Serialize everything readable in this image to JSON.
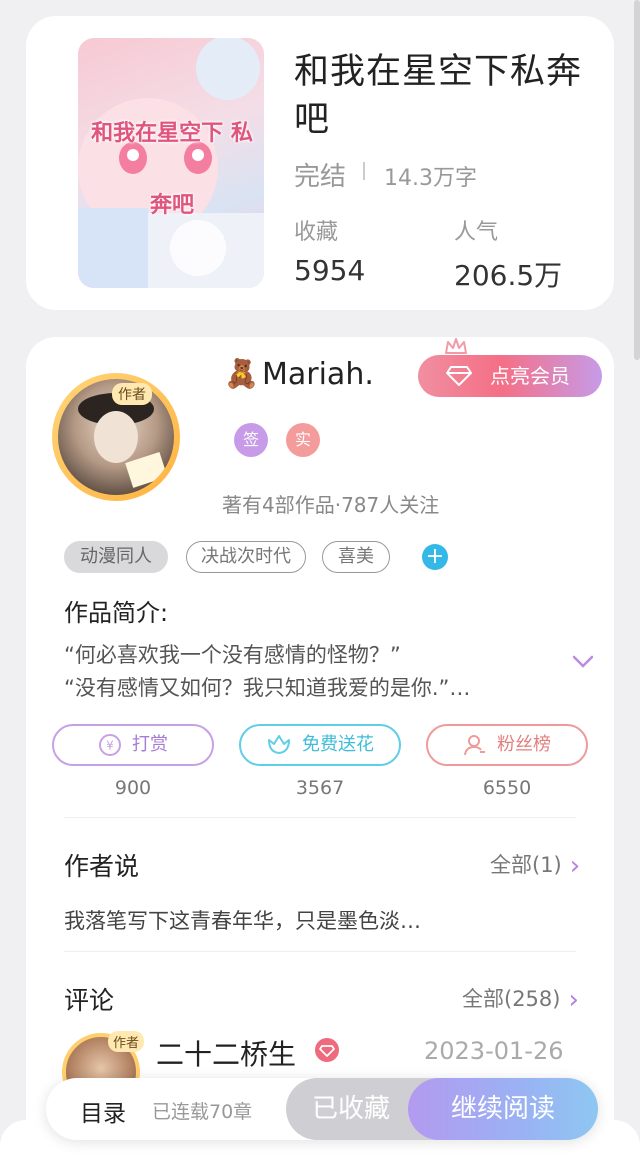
{
  "book": {
    "title": "和我在星空下私奔吧",
    "status": "完结",
    "words": "14.3万字",
    "collect_label": "收藏",
    "collect_value": "5954",
    "popularity_label": "人气",
    "popularity_value": "206.5万",
    "cover_text": "和我在星空下 私奔吧"
  },
  "author": {
    "emoji": "🧸",
    "name": "Mariah.",
    "avatar_badge": "作者",
    "vip_label": "点亮会员",
    "badge_sign": "签",
    "badge_real": "实",
    "stats": "著有4部作品·787人关注"
  },
  "tags": [
    "动漫同人",
    "决战次时代",
    "喜美"
  ],
  "intro": {
    "title": "作品简介:",
    "line1": "“何必喜欢我一个没有感情的怪物？”",
    "line2": "“没有感情又如何？我只知道我爱的是你.”…"
  },
  "actions": [
    {
      "label": "打赏",
      "count": "900",
      "color": "#c7a1e6"
    },
    {
      "label": "免费送花",
      "count": "3567",
      "color": "#5ecfe6"
    },
    {
      "label": "粉丝榜",
      "count": "6550",
      "color": "#ef9b9b"
    }
  ],
  "author_says": {
    "title": "作者说",
    "more": "全部(1)",
    "text": "我落笔写下这青春年华，只是墨色淡…"
  },
  "comments": {
    "title": "评论",
    "more": "全部(258)",
    "first": {
      "name": "二十二桥生",
      "date": "2023-01-26",
      "avatar_badge": "作者"
    }
  },
  "bottom": {
    "toc": "目录",
    "serial": "已连载70章",
    "collected": "已收藏",
    "continue": "继续阅读"
  }
}
